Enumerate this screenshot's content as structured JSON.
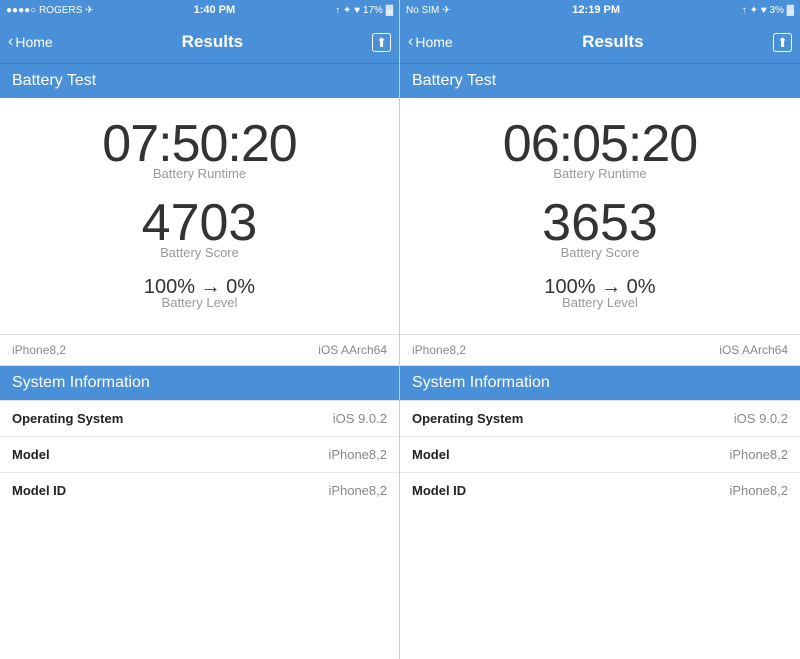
{
  "panels": [
    {
      "id": "panel-left",
      "status_bar": {
        "left": "●●●●○ ROGERS ✈",
        "center": "1:40 PM",
        "right": "↑ ✦ ♥ 17% ▓"
      },
      "nav": {
        "back_label": "Home",
        "title": "Results",
        "share_label": "⬆"
      },
      "section_header": "Battery Test",
      "battery_runtime": "07:50:20",
      "battery_runtime_label": "Battery Runtime",
      "battery_score": "4703",
      "battery_score_label": "Battery Score",
      "battery_level": "100% → 0%",
      "battery_level_label": "Battery Level",
      "device_left": "iPhone8,2",
      "device_right": "iOS AArch64",
      "sys_info_header": "System Information",
      "sys_info_rows": [
        {
          "key": "Operating System",
          "value": "iOS 9.0.2"
        },
        {
          "key": "Model",
          "value": "iPhone8,2"
        },
        {
          "key": "Model ID",
          "value": "iPhone8,2"
        }
      ]
    },
    {
      "id": "panel-right",
      "status_bar": {
        "left": "No SIM ✈",
        "center": "12:19 PM",
        "right": "↑ ✦ ♥ 3% ▓"
      },
      "nav": {
        "back_label": "Home",
        "title": "Results",
        "share_label": "⬆"
      },
      "section_header": "Battery Test",
      "battery_runtime": "06:05:20",
      "battery_runtime_label": "Battery Runtime",
      "battery_score": "3653",
      "battery_score_label": "Battery Score",
      "battery_level": "100% → 0%",
      "battery_level_label": "Battery Level",
      "device_left": "iPhone8,2",
      "device_right": "iOS AArch64",
      "sys_info_header": "System Information",
      "sys_info_rows": [
        {
          "key": "Operating System",
          "value": "iOS 9.0.2"
        },
        {
          "key": "Model",
          "value": "iPhone8,2"
        },
        {
          "key": "Model ID",
          "value": "iPhone8,2"
        }
      ]
    }
  ]
}
